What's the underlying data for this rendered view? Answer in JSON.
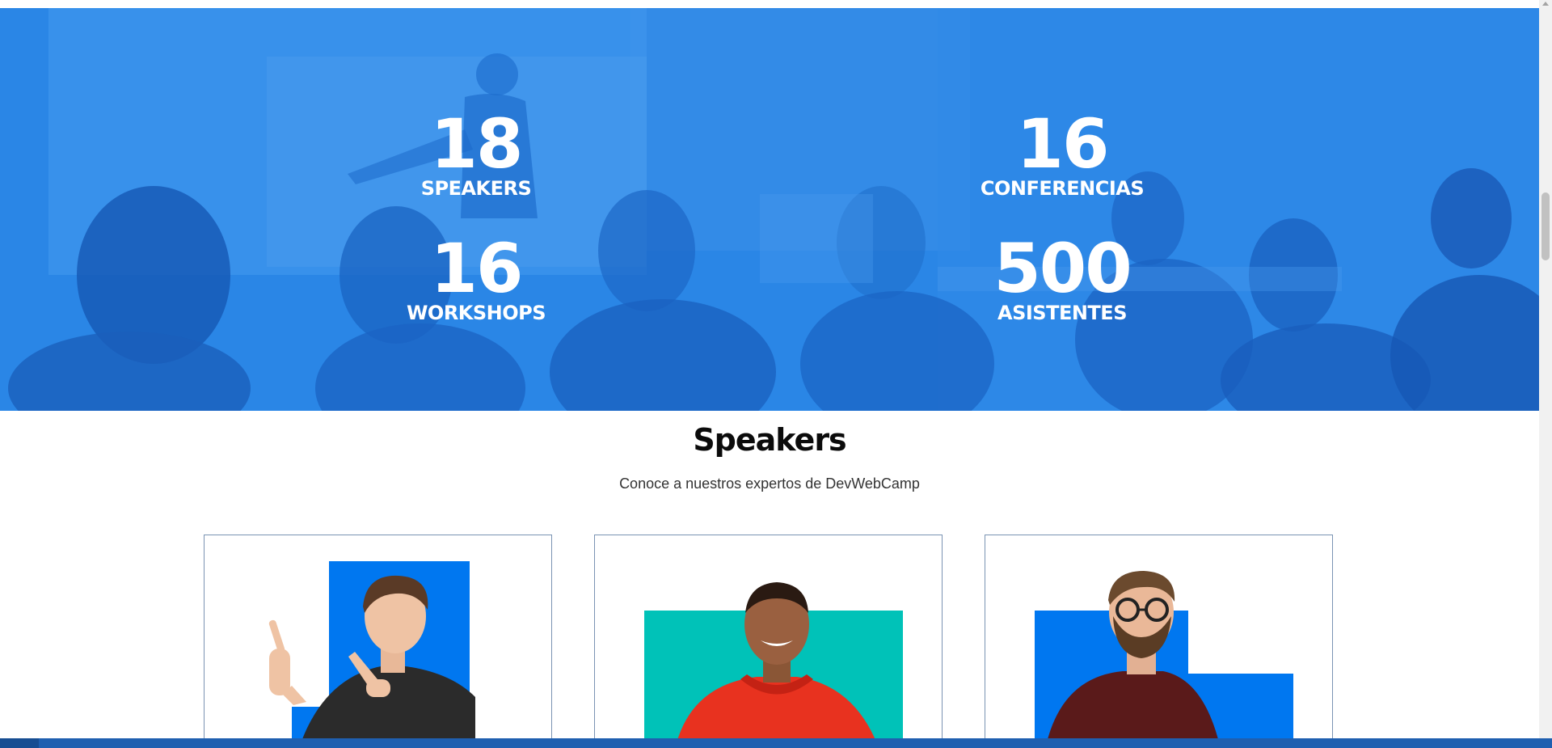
{
  "stats": [
    {
      "number": "18",
      "label": "SPEAKERS"
    },
    {
      "number": "16",
      "label": "CONFERENCIAS"
    },
    {
      "number": "16",
      "label": "WORKSHOPS"
    },
    {
      "number": "500",
      "label": "ASISTENTES"
    }
  ],
  "speakers_section": {
    "title": "Speakers",
    "subtitle": "Conoce a nuestros expertos de DevWebCamp"
  },
  "colors": {
    "hero_overlay": "#2a86e6",
    "primary_blue": "#0077f0",
    "teal": "#00c2b8",
    "card_border": "#7a93b3"
  }
}
